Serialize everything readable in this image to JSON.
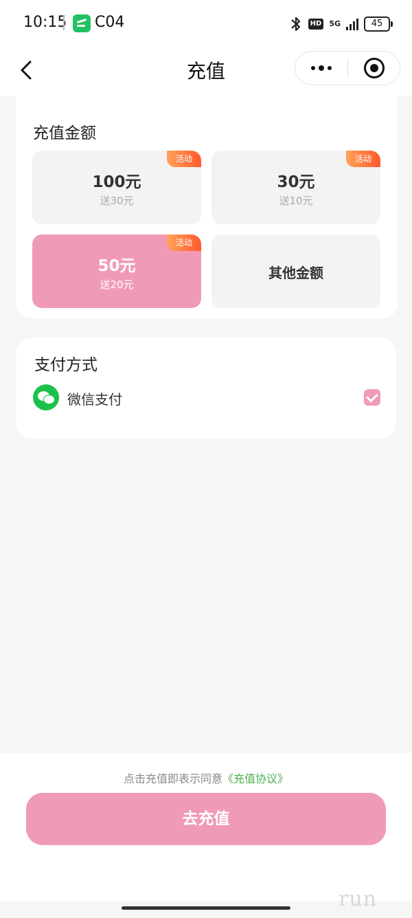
{
  "status_bar": {
    "time": "10:15",
    "app_name": "C04",
    "app_icon": "app-icon",
    "hd_label": "HD",
    "network_label": "5G",
    "battery_level": "45"
  },
  "nav": {
    "title": "充值",
    "back_icon": "chevron-left-icon",
    "more_icon": "more-dots-icon",
    "close_icon": "target-circle-icon"
  },
  "recharge": {
    "title": "充值金额",
    "badge_label": "活动",
    "options": [
      {
        "amount": "100元",
        "bonus": "送30元"
      },
      {
        "amount": "30元",
        "bonus": "送10元"
      },
      {
        "amount": "50元",
        "bonus": "送20元"
      },
      {
        "amount": "其他金额"
      }
    ],
    "selected_index": 2
  },
  "payment": {
    "title": "支付方式",
    "method_label": "微信支付",
    "method_icon": "wechat-icon",
    "checked": true
  },
  "bottom": {
    "agreement_prefix": "点击充值即表示同意",
    "agreement_link": "《充值协议》",
    "button_label": "去充值"
  },
  "watermark": "run",
  "colors": {
    "accent_pink": "#f09bb6",
    "badge_orange": "#ff5a2b",
    "wechat_green": "#1bc14a",
    "link_green": "#4ab04f"
  }
}
